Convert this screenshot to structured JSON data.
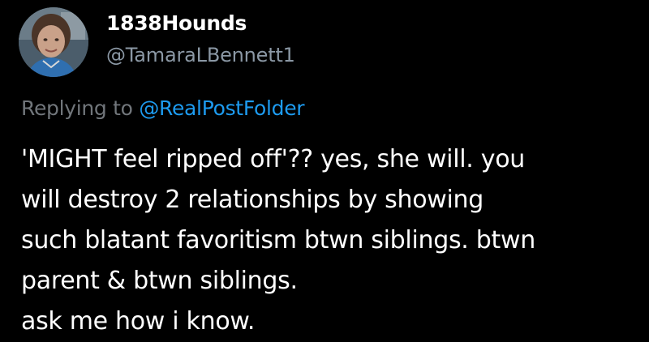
{
  "author": {
    "display_name": "1838Hounds",
    "handle": "@TamaraLBennett1"
  },
  "reply": {
    "prefix": "Replying to",
    "target": "@RealPostFolder"
  },
  "tweet": {
    "lines": [
      "'MIGHT feel ripped off'?? yes, she will. you",
      "will destroy 2 relationships by showing",
      "such blatant favoritism btwn siblings. btwn",
      "parent & btwn siblings.",
      "ask me how i know."
    ]
  },
  "colors": {
    "background": "#000000",
    "primary_text": "#ffffff",
    "secondary_text": "#71767b",
    "link": "#1d9bf0"
  },
  "icons": {
    "avatar": "profile-photo"
  }
}
